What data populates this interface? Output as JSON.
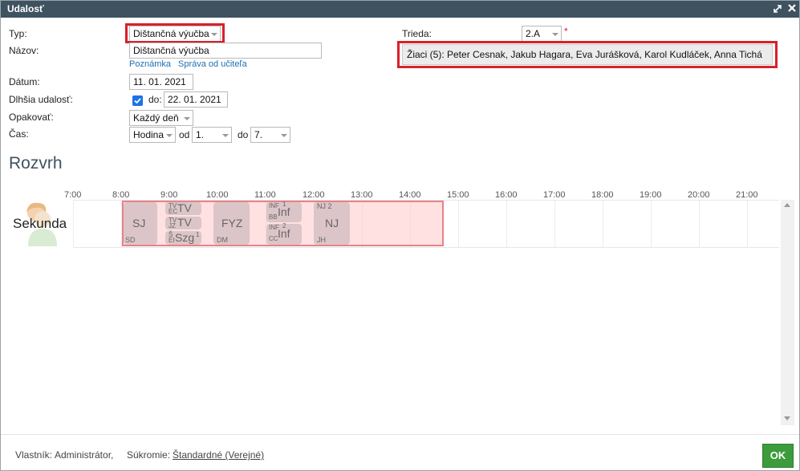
{
  "window": {
    "title": "Udalosť",
    "icons": [
      "expand-icon",
      "close-icon"
    ]
  },
  "form": {
    "type_label": "Typ:",
    "type_value": "Dištančná výučba",
    "name_label": "Názov:",
    "name_value": "Dištančná výučba",
    "note_link": "Poznámka",
    "teacher_msg_link": "Správa od učiteľa",
    "date_label": "Dátum:",
    "date_value": "11. 01. 2021",
    "longer_label": "Dlhšia udalosť:",
    "longer_checked": true,
    "to_label": "do:",
    "to_value": "22. 01. 2021",
    "repeat_label": "Opakovať:",
    "repeat_value": "Každý deň",
    "time_label": "Čas:",
    "time_unit_value": "Hodina",
    "from_label": "od",
    "from_value": "1.",
    "until_label": "do",
    "until_value": "7.",
    "class_label": "Trieda:",
    "class_value": "2.A",
    "required_mark": "*",
    "students_button": "Žiaci (5): Peter Cesnak, Jakub Hagara, Eva Jurášková, Karol Kudláček, Anna Tichá"
  },
  "schedule": {
    "title": "Rozvrh",
    "row_label": "Sekunda",
    "hours": [
      "7:00",
      "8:00",
      "9:00",
      "10:00",
      "11:00",
      "12:00",
      "13:00",
      "14:00",
      "15:00",
      "16:00",
      "17:00",
      "18:00",
      "19:00",
      "20:00",
      "21:00"
    ],
    "lessons": [
      {
        "subject": "SJ",
        "teacher": "SD"
      },
      {
        "subject": "TV",
        "group": "TV",
        "teacher": "EC"
      },
      {
        "subject": "TV",
        "group": "TV",
        "teacher": "JZ"
      },
      {
        "subject": "Szg",
        "group": "Š",
        "teacher": "EI",
        "sup": "1"
      },
      {
        "subject": "FYZ",
        "teacher": "DM"
      },
      {
        "subject": "Inf",
        "group": "INF",
        "teacher": "BB",
        "sup": "1"
      },
      {
        "subject": "Inf",
        "group": "INF",
        "teacher": "CC",
        "sup": "2"
      },
      {
        "subject": "NJ",
        "group": "NJ 2",
        "teacher": "JH"
      }
    ]
  },
  "footer": {
    "owner_label": "Vlastník:",
    "owner_value": "Administrátor,",
    "privacy_label": "Súkromie:",
    "privacy_value": "Štandardné (Verejné)",
    "ok_button": "OK"
  },
  "colors": {
    "titlebar": "#3f5260",
    "highlight": "#d9202a",
    "ok": "#3c9c3c",
    "event": "#ffc8c8",
    "lesson": "#dcc5c8"
  }
}
